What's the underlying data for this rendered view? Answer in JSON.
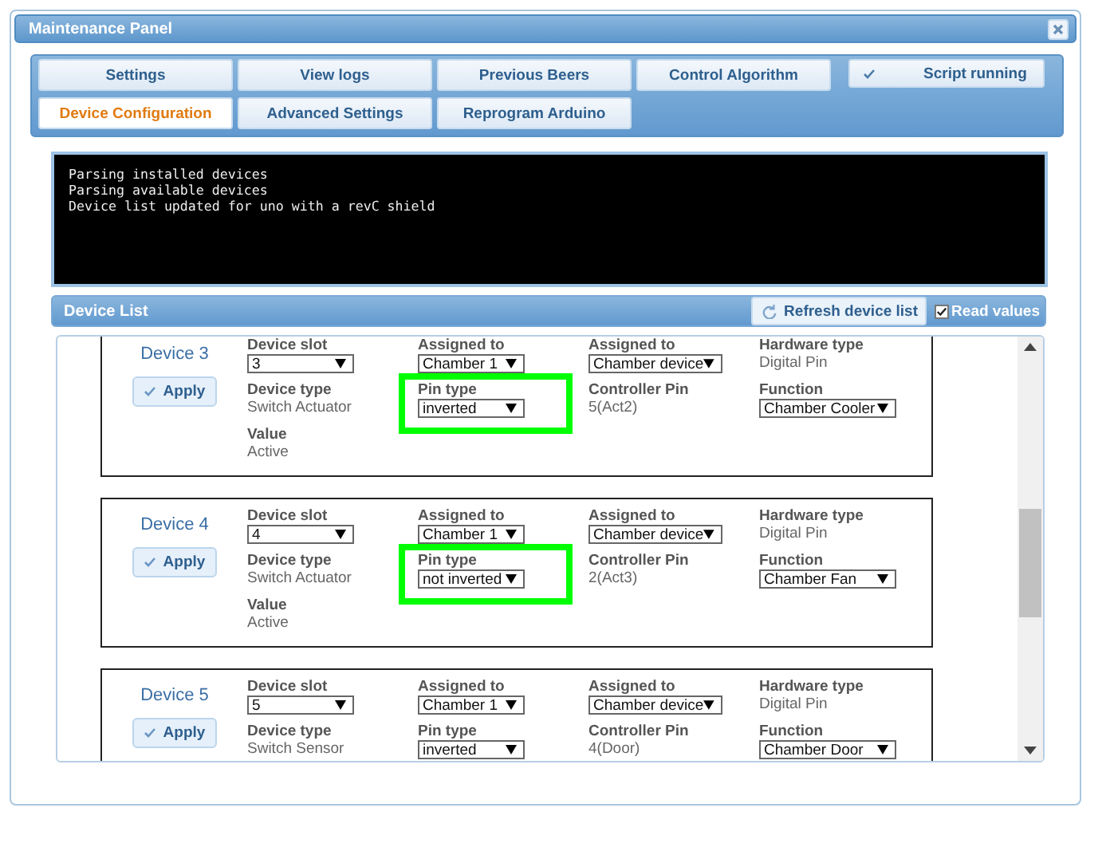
{
  "window": {
    "title": "Maintenance Panel"
  },
  "tabs": [
    {
      "label": "Settings",
      "selected": false
    },
    {
      "label": "View logs",
      "selected": false
    },
    {
      "label": "Previous Beers",
      "selected": false
    },
    {
      "label": "Control Algorithm",
      "selected": false
    },
    {
      "label": "Device Configuration",
      "selected": true
    },
    {
      "label": "Advanced Settings",
      "selected": false
    },
    {
      "label": "Reprogram Arduino",
      "selected": false
    }
  ],
  "status_button": {
    "label": "Script running",
    "checked": true
  },
  "console": [
    "Parsing installed devices",
    "Parsing available devices",
    "Device list updated for uno with a revC shield"
  ],
  "device_list": {
    "title": "Device List",
    "refresh_label": "Refresh device list",
    "read_values": {
      "label": "Read values",
      "checked": true
    },
    "devices": [
      {
        "name": "Device 3",
        "apply_label": "Apply",
        "columns": [
          [
            {
              "kind": "select",
              "label": "Device slot",
              "value": "3"
            },
            {
              "kind": "text",
              "label": "Device type",
              "value": "Switch Actuator"
            },
            {
              "kind": "text",
              "label": "Value",
              "value": "Active"
            }
          ],
          [
            {
              "kind": "select",
              "label": "Assigned to",
              "value": "Chamber 1"
            },
            {
              "kind": "select",
              "label": "Pin type",
              "value": "inverted",
              "highlighted": true
            }
          ],
          [
            {
              "kind": "select",
              "label": "Assigned to",
              "value": "Chamber device"
            },
            {
              "kind": "text",
              "label": "Controller Pin",
              "value": "5(Act2)"
            }
          ],
          [
            {
              "kind": "text",
              "label": "Hardware type",
              "value": "Digital Pin"
            },
            {
              "kind": "select",
              "label": "Function",
              "value": "Chamber Cooler"
            }
          ]
        ]
      },
      {
        "name": "Device 4",
        "apply_label": "Apply",
        "columns": [
          [
            {
              "kind": "select",
              "label": "Device slot",
              "value": "4"
            },
            {
              "kind": "text",
              "label": "Device type",
              "value": "Switch Actuator"
            },
            {
              "kind": "text",
              "label": "Value",
              "value": "Active"
            }
          ],
          [
            {
              "kind": "select",
              "label": "Assigned to",
              "value": "Chamber 1"
            },
            {
              "kind": "select",
              "label": "Pin type",
              "value": "not inverted",
              "highlighted": true
            }
          ],
          [
            {
              "kind": "select",
              "label": "Assigned to",
              "value": "Chamber device"
            },
            {
              "kind": "text",
              "label": "Controller Pin",
              "value": "2(Act3)"
            }
          ],
          [
            {
              "kind": "text",
              "label": "Hardware type",
              "value": "Digital Pin"
            },
            {
              "kind": "select",
              "label": "Function",
              "value": "Chamber Fan"
            }
          ]
        ]
      },
      {
        "name": "Device 5",
        "apply_label": "Apply",
        "columns": [
          [
            {
              "kind": "select",
              "label": "Device slot",
              "value": "5"
            },
            {
              "kind": "text",
              "label": "Device type",
              "value": "Switch Sensor"
            }
          ],
          [
            {
              "kind": "select",
              "label": "Assigned to",
              "value": "Chamber 1"
            },
            {
              "kind": "select",
              "label": "Pin type",
              "value": "inverted",
              "highlighted": false
            }
          ],
          [
            {
              "kind": "select",
              "label": "Assigned to",
              "value": "Chamber device"
            },
            {
              "kind": "text",
              "label": "Controller Pin",
              "value": "4(Door)"
            }
          ],
          [
            {
              "kind": "text",
              "label": "Hardware type",
              "value": "Digital Pin"
            },
            {
              "kind": "select",
              "label": "Function",
              "value": "Chamber Door"
            }
          ]
        ]
      }
    ]
  }
}
